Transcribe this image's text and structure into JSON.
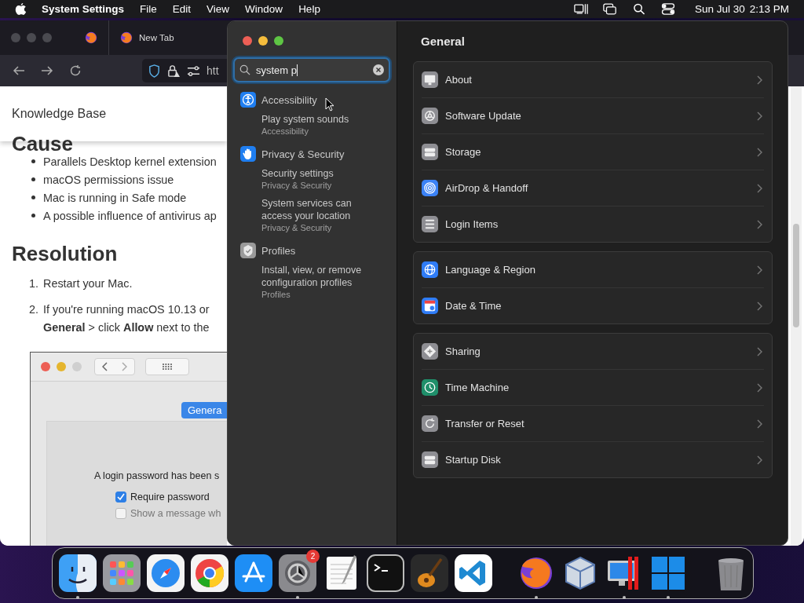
{
  "menu_bar": {
    "app": "System Settings",
    "menus": [
      "File",
      "Edit",
      "View",
      "Window",
      "Help"
    ],
    "date": "Sun Jul 30",
    "time": "2:13 PM"
  },
  "browser": {
    "tabs": [
      {
        "label": "New Tab"
      }
    ],
    "address": "htt",
    "page": {
      "header": "Knowledge Base",
      "cause_heading": "Cause",
      "causes": [
        "Parallels Desktop kernel extension",
        "macOS permissions issue",
        "Mac is running in Safe mode",
        "A possible influence of antivirus ap"
      ],
      "resolution_heading": "Resolution",
      "steps": [
        {
          "number": "1.",
          "lines": [
            "Restart your Mac."
          ]
        },
        {
          "number": "2.",
          "lines": [
            "If you're running macOS 10.13 or",
            "**General** > click **Allow** next to the"
          ]
        }
      ],
      "screenshot": {
        "tab": "Genera",
        "message": "A login password has been s",
        "options": [
          {
            "label": "Require password",
            "checked": true
          },
          {
            "label": "Show a message wh",
            "checked": false
          }
        ]
      }
    }
  },
  "settings": {
    "search": {
      "value": "system p"
    },
    "results": [
      {
        "title": "Accessibility",
        "kind": "accessibility",
        "items": [
          {
            "title": "Play system sounds",
            "category": "Accessibility"
          }
        ]
      },
      {
        "title": "Privacy & Security",
        "kind": "privacy",
        "items": [
          {
            "title": "Security settings",
            "category": "Privacy & Security"
          },
          {
            "title": "System services can access your location",
            "category": "Privacy & Security"
          }
        ]
      },
      {
        "title": "Profiles",
        "kind": "profiles",
        "items": [
          {
            "title": "Install, view, or remove configuration profiles",
            "category": "Profiles"
          }
        ]
      }
    ],
    "title": "General",
    "groups": [
      [
        {
          "label": "About",
          "kind": "about"
        },
        {
          "label": "Software Update",
          "kind": "update"
        },
        {
          "label": "Storage",
          "kind": "storage"
        },
        {
          "label": "AirDrop & Handoff",
          "kind": "airdrop"
        },
        {
          "label": "Login Items",
          "kind": "login"
        }
      ],
      [
        {
          "label": "Language & Region",
          "kind": "language"
        },
        {
          "label": "Date & Time",
          "kind": "datetime"
        }
      ],
      [
        {
          "label": "Sharing",
          "kind": "sharing"
        },
        {
          "label": "Time Machine",
          "kind": "timemachine"
        },
        {
          "label": "Transfer or Reset",
          "kind": "transfer"
        },
        {
          "label": "Startup Disk",
          "kind": "storage"
        }
      ]
    ]
  },
  "dock": [
    {
      "kind": "finder",
      "running": true
    },
    {
      "kind": "launchpad",
      "running": false
    },
    {
      "kind": "safari",
      "running": false
    },
    {
      "kind": "chrome",
      "running": false
    },
    {
      "kind": "appstore",
      "running": false
    },
    {
      "kind": "settings",
      "running": true,
      "badge": "2"
    },
    {
      "kind": "textedit",
      "running": false
    },
    {
      "kind": "terminal",
      "running": false
    },
    {
      "kind": "garageband",
      "running": false
    },
    {
      "kind": "vscode",
      "running": false
    },
    {
      "kind": "separator"
    },
    {
      "kind": "firefox",
      "running": true
    },
    {
      "kind": "virtualbox",
      "running": false
    },
    {
      "kind": "parallels",
      "running": true
    },
    {
      "kind": "windows",
      "running": true
    },
    {
      "kind": "separator"
    },
    {
      "kind": "trash",
      "running": false
    }
  ]
}
